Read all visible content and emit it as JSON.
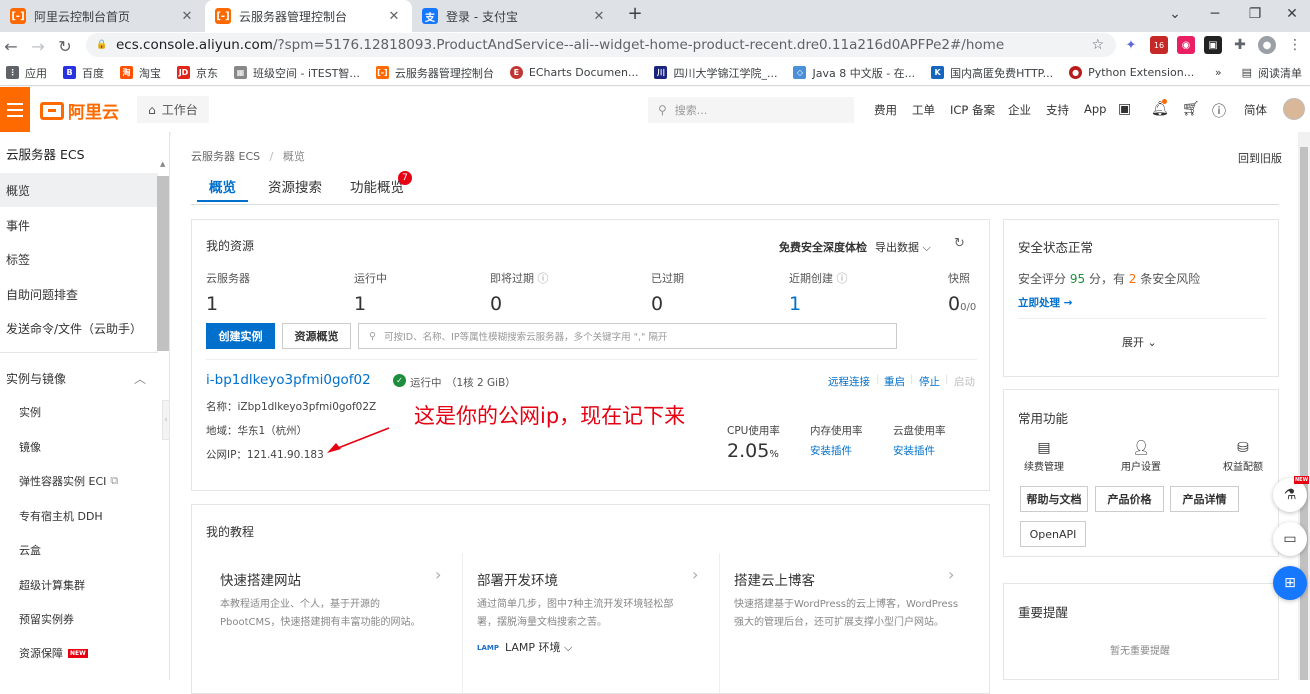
{
  "browser": {
    "tabs": [
      {
        "title": "阿里云控制台首页",
        "active": false
      },
      {
        "title": "云服务器管理控制台",
        "active": true
      },
      {
        "title": "登录 - 支付宝",
        "active": false
      }
    ],
    "url_host": "ecs.console.aliyun.com",
    "url_rest": "/?spm=5176.12818093.ProductAndService--ali--widget-home-product-recent.dre0.11a216d0APFPe2#/home",
    "ext_badge": "16",
    "bookmarks": [
      "应用",
      "百度",
      "淘宝",
      "京东",
      "班级空间 - iTEST智...",
      "云服务器管理控制台",
      "ECharts Documen...",
      "四川大学锦江学院_...",
      "Java 8 中文版 - 在...",
      "国内高匿免费HTTP...",
      "Python Extension..."
    ],
    "bookmarks_more": "»",
    "reading_list": "阅读清单"
  },
  "header": {
    "logo_text": "阿里云",
    "workbench": "工作台",
    "search_placeholder": "搜索...",
    "links": [
      "费用",
      "工单",
      "ICP 备案",
      "企业",
      "支持",
      "App"
    ],
    "lang": "简体"
  },
  "sidebar": {
    "title": "云服务器 ECS",
    "items": [
      "概览",
      "事件",
      "标签",
      "自助问题排查",
      "发送命令/文件（云助手）"
    ],
    "group": "实例与镜像",
    "sub_items": [
      "实例",
      "镜像",
      "弹性容器实例 ECI",
      "专有宿主机 DDH",
      "云盒",
      "超级计算集群",
      "预留实例券",
      "资源保障"
    ],
    "new_badge": "NEW"
  },
  "main": {
    "breadcrumb_root": "云服务器 ECS",
    "breadcrumb_sep": "/",
    "breadcrumb_current": "概览",
    "back_old": "回到旧版",
    "tabs": [
      "概览",
      "资源搜索",
      "功能概览"
    ],
    "tab_badge": "7",
    "resources": {
      "title": "我的资源",
      "deep_check": "免费安全深度体检",
      "export": "导出数据",
      "stats": [
        {
          "label": "云服务器",
          "value": "1"
        },
        {
          "label": "运行中",
          "value": "1"
        },
        {
          "label": "即将过期",
          "value": "0"
        },
        {
          "label": "已过期",
          "value": "0"
        },
        {
          "label": "近期创建",
          "value": "1"
        },
        {
          "label": "快照",
          "value": "0",
          "suffix": "0/0"
        }
      ],
      "create_btn": "创建实例",
      "overview_btn": "资源概览",
      "search_placeholder": "可按ID、名称、IP等属性模糊搜索云服务器，多个关键字用 \",\" 隔开",
      "instance": {
        "id": "i-bp1dlkeyo3pfmi0gof02",
        "status": "运行中",
        "spec": "（1核 2 GiB）",
        "actions": [
          "远程连接",
          "重启",
          "停止",
          "启动"
        ],
        "name_line": "名称：iZbp1dlkeyo3pfmi0gof02Z",
        "region_line": "地域：华东1（杭州）",
        "ip_line": "公网IP：121.41.90.183",
        "cpu_label": "CPU使用率",
        "cpu_value": "2.05",
        "cpu_unit": "%",
        "mem_label": "内存使用率",
        "mem_action": "安装插件",
        "disk_label": "云盘使用率",
        "disk_action": "安装插件"
      }
    },
    "annotation": "这是你的公网ip，现在记下来",
    "tutorials": {
      "title": "我的教程",
      "cards": [
        {
          "title": "快速搭建网站",
          "desc": "本教程适用企业、个人，基于开源的PbootCMS，快速搭建拥有丰富功能的网站。"
        },
        {
          "title": "部署开发环境",
          "desc": "通过简单几步，图中7种主流开发环境轻松部署，摆脱海量文档搜索之苦。",
          "extra": "LAMP 环境"
        },
        {
          "title": "搭建云上博客",
          "desc": "快速搭建基于WordPress的云上博客，WordPress强大的管理后台，还可扩展支撑小型门户网站。"
        }
      ]
    },
    "security": {
      "title": "安全状态正常",
      "score_text_1": "安全评分",
      "score": "95",
      "score_text_2": "分，有",
      "risk_count": "2",
      "score_text_3": "条安全风险",
      "action": "立即处理 →",
      "expand": "展开"
    },
    "common": {
      "title": "常用功能",
      "icons": [
        "续费管理",
        "用户设置",
        "权益配额"
      ],
      "buttons": [
        "帮助与文档",
        "产品价格",
        "产品详情",
        "OpenAPI"
      ]
    },
    "notice": {
      "title": "重要提醒",
      "empty": "暂无重要提醒"
    }
  },
  "colors": {
    "brand": "#ff6a00",
    "link": "#0070cc",
    "annotation": "#e60012",
    "ok": "#1e8e3e"
  }
}
